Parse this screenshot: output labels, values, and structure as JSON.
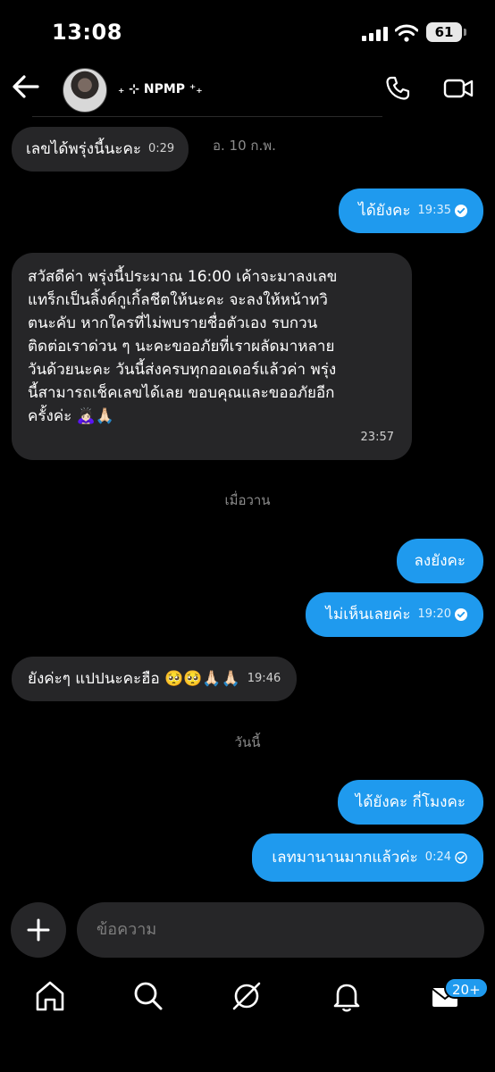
{
  "status_bar": {
    "time": "13:08",
    "battery": "61"
  },
  "header": {
    "contact_name": "₊ ⊹ NPMP ⁺₊"
  },
  "messages": [
    {
      "side": "in",
      "text": "เลขได้พรุ่งนี้นะคะ",
      "time": "0:29"
    },
    {
      "side": "date",
      "text": "อ. 10 ก.พ."
    },
    {
      "side": "out",
      "text": "ได้ยังคะ",
      "time": "19:35",
      "read": true
    },
    {
      "side": "in",
      "lines": [
        "สวัสดีค่า พรุ่งนี้ประมาณ 16:00 เค้าจะมาลงเลข",
        "แทร็กเป็นลิ้งค์กูเกิ้ลชีตให้นะคะ จะลงให้หน้าทวิ",
        "ตนะคับ หากใครที่ไม่พบรายชื่อตัวเอง รบกวน",
        "ติดต่อเราด่วน ๆ นะคะขออภัยที่เราผลัดมาหลาย",
        "วันด้วยนะคะ วันนี้ส่งครบทุกออเดอร์แล้วค่า พรุ่ง",
        "นี้สามารถเช็คเลขได้เลย ขอบคุณและขออภัยอีก",
        "ครั้งค่ะ 🙇🏻‍♀️🙏🏻"
      ],
      "time": "23:57"
    },
    {
      "side": "date",
      "text": "เมื่อวาน"
    },
    {
      "side": "out",
      "text": "ลงยังคะ"
    },
    {
      "side": "out",
      "text": "ไม่เห็นเลยค่ะ",
      "time": "19:20",
      "read": true
    },
    {
      "side": "in",
      "text": "ยังค่ะๆ แปปนะคะฮือ 🥺🥺🙏🏻🙏🏻",
      "time": "19:46"
    },
    {
      "side": "date",
      "text": "วันนี้"
    },
    {
      "side": "out",
      "text": "ได้ยังคะ กี่โมงคะ"
    },
    {
      "side": "out",
      "text": "เลทมานานมากแล้วค่ะ",
      "time": "0:24",
      "read": false
    }
  ],
  "composer": {
    "placeholder": "ข้อความ"
  },
  "tabbar": {
    "inbox_badge": "20+"
  },
  "colors": {
    "background": "#000000",
    "bubble_out": "#1f9aee",
    "bubble_in": "#262628",
    "muted_text": "#8c8c8c"
  }
}
